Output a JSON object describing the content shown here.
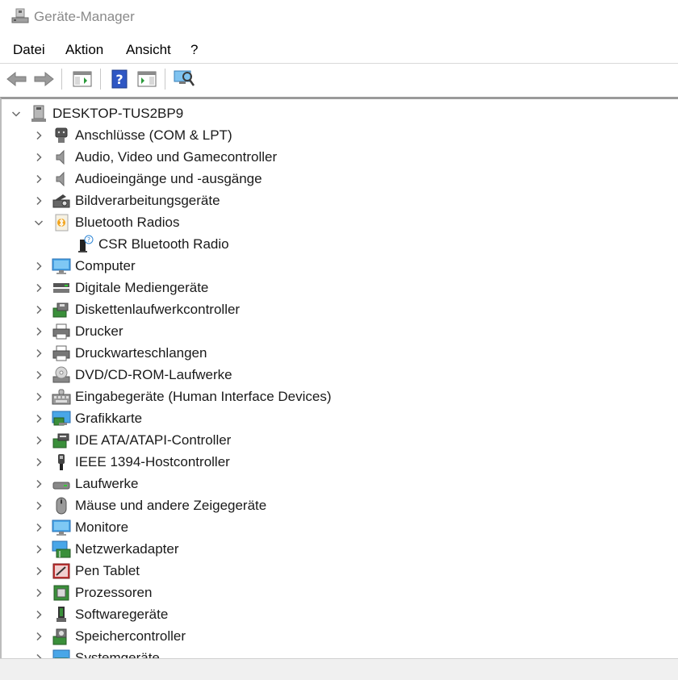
{
  "window": {
    "title": "Geräte-Manager"
  },
  "menu": [
    "Datei",
    "Aktion",
    "Ansicht",
    "?"
  ],
  "toolbar": {
    "buttons": [
      "back-arrow-icon",
      "forward-arrow-icon",
      "show-hide-console-tree-icon",
      "help-icon",
      "properties-icon",
      "scan-hardware-icon"
    ]
  },
  "tree": {
    "root": {
      "label": "DESKTOP-TUS2BP9",
      "icon": "computer-tower-icon",
      "expanded": true
    },
    "items": [
      {
        "label": "Anschlüsse (COM & LPT)",
        "icon": "port-icon",
        "expanded": false
      },
      {
        "label": "Audio, Video und Gamecontroller",
        "icon": "speaker-icon",
        "expanded": false
      },
      {
        "label": "Audioeingänge und -ausgänge",
        "icon": "speaker-icon",
        "expanded": false
      },
      {
        "label": "Bildverarbeitungsgeräte",
        "icon": "camera-icon",
        "expanded": false
      },
      {
        "label": "Bluetooth Radios",
        "icon": "bluetooth-icon",
        "expanded": true,
        "children": [
          {
            "label": "CSR Bluetooth Radio",
            "icon": "bluetooth-device-unknown-icon"
          }
        ]
      },
      {
        "label": "Computer",
        "icon": "monitor-icon",
        "expanded": false
      },
      {
        "label": "Digitale Mediengeräte",
        "icon": "media-device-icon",
        "expanded": false
      },
      {
        "label": "Diskettenlaufwerkcontroller",
        "icon": "floppy-controller-icon",
        "expanded": false
      },
      {
        "label": "Drucker",
        "icon": "printer-icon",
        "expanded": false
      },
      {
        "label": "Druckwarteschlangen",
        "icon": "printer-icon",
        "expanded": false
      },
      {
        "label": "DVD/CD-ROM-Laufwerke",
        "icon": "disc-drive-icon",
        "expanded": false
      },
      {
        "label": "Eingabegeräte (Human Interface Devices)",
        "icon": "keyboard-icon",
        "expanded": false
      },
      {
        "label": "Grafikkarte",
        "icon": "display-adapter-icon",
        "expanded": false
      },
      {
        "label": "IDE ATA/ATAPI-Controller",
        "icon": "ide-controller-icon",
        "expanded": false
      },
      {
        "label": "IEEE 1394-Hostcontroller",
        "icon": "firewire-icon",
        "expanded": false
      },
      {
        "label": "Laufwerke",
        "icon": "drive-icon",
        "expanded": false
      },
      {
        "label": "Mäuse und andere Zeigegeräte",
        "icon": "mouse-icon",
        "expanded": false
      },
      {
        "label": "Monitore",
        "icon": "monitor-icon",
        "expanded": false
      },
      {
        "label": "Netzwerkadapter",
        "icon": "network-adapter-icon",
        "expanded": false
      },
      {
        "label": "Pen Tablet",
        "icon": "pen-tablet-icon",
        "expanded": false
      },
      {
        "label": "Prozessoren",
        "icon": "processor-icon",
        "expanded": false
      },
      {
        "label": "Softwaregeräte",
        "icon": "software-device-icon",
        "expanded": false
      },
      {
        "label": "Speichercontroller",
        "icon": "storage-controller-icon",
        "expanded": false
      },
      {
        "label": "Systemgeräte",
        "icon": "system-device-icon",
        "expanded": false
      }
    ]
  },
  "colors": {
    "chevron": "#6b6b6b",
    "accent": "#2f86d6",
    "text": "#1a1a1a"
  }
}
